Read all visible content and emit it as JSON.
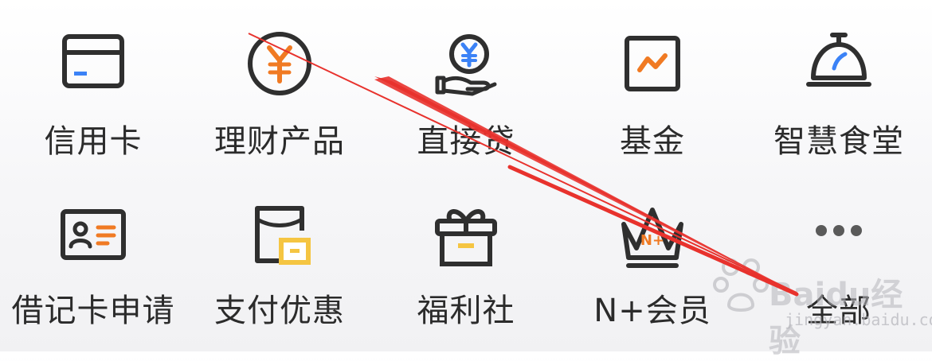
{
  "colors": {
    "orange": "#f07a23",
    "blue": "#3b82f6",
    "yellow": "#f5c542",
    "dark": "#2f2f2f",
    "annotation_red": "#e8322d"
  },
  "menu": {
    "items": [
      {
        "label": "信用卡",
        "icon": "credit-card-icon"
      },
      {
        "label": "理财产品",
        "icon": "yen-coin-icon"
      },
      {
        "label": "直接贷",
        "icon": "loan-hand-icon"
      },
      {
        "label": "基金",
        "icon": "fund-chart-icon"
      },
      {
        "label": "智慧食堂",
        "icon": "dining-cloche-icon"
      },
      {
        "label": "借记卡申请",
        "icon": "id-card-icon"
      },
      {
        "label": "支付优惠",
        "icon": "payment-discount-icon"
      },
      {
        "label": "福利社",
        "icon": "gift-box-icon"
      },
      {
        "label": "N+会员",
        "icon": "crown-icon"
      },
      {
        "label": "全部",
        "icon": "more-dots-icon"
      }
    ]
  },
  "watermark": {
    "text": "Baidu经验",
    "sub": "jingyan.baidu.com"
  }
}
